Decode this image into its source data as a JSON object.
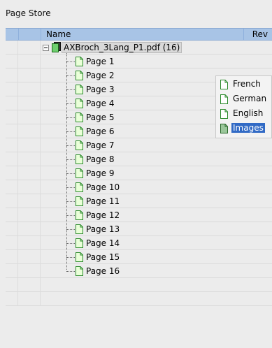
{
  "panel": {
    "title": "Page Store"
  },
  "header": {
    "name_label": "Name",
    "rev_label": "Rev"
  },
  "root": {
    "label": "AXBroch_3Lang_P1.pdf (16)"
  },
  "pages": [
    {
      "label": "Page 1"
    },
    {
      "label": "Page 2"
    },
    {
      "label": "Page 3"
    },
    {
      "label": "Page 4"
    },
    {
      "label": "Page 5"
    },
    {
      "label": "Page 6"
    },
    {
      "label": "Page 7"
    },
    {
      "label": "Page 8"
    },
    {
      "label": "Page 9"
    },
    {
      "label": "Page 10"
    },
    {
      "label": "Page 11"
    },
    {
      "label": "Page 12"
    },
    {
      "label": "Page 13"
    },
    {
      "label": "Page 14"
    },
    {
      "label": "Page 15"
    },
    {
      "label": "Page 16"
    }
  ],
  "layers_popup": {
    "items": [
      {
        "label": "French",
        "icon": "page-icon"
      },
      {
        "label": "German",
        "icon": "page-icon"
      },
      {
        "label": "English",
        "icon": "page-icon"
      },
      {
        "label": "Images",
        "icon": "layer-icon",
        "selected": true
      }
    ]
  },
  "colors": {
    "header_bg": "#a8c4e6",
    "selection": "#316ac5",
    "page_icon_fill": "#eaffd9",
    "page_icon_stroke": "#2a8a2a"
  }
}
